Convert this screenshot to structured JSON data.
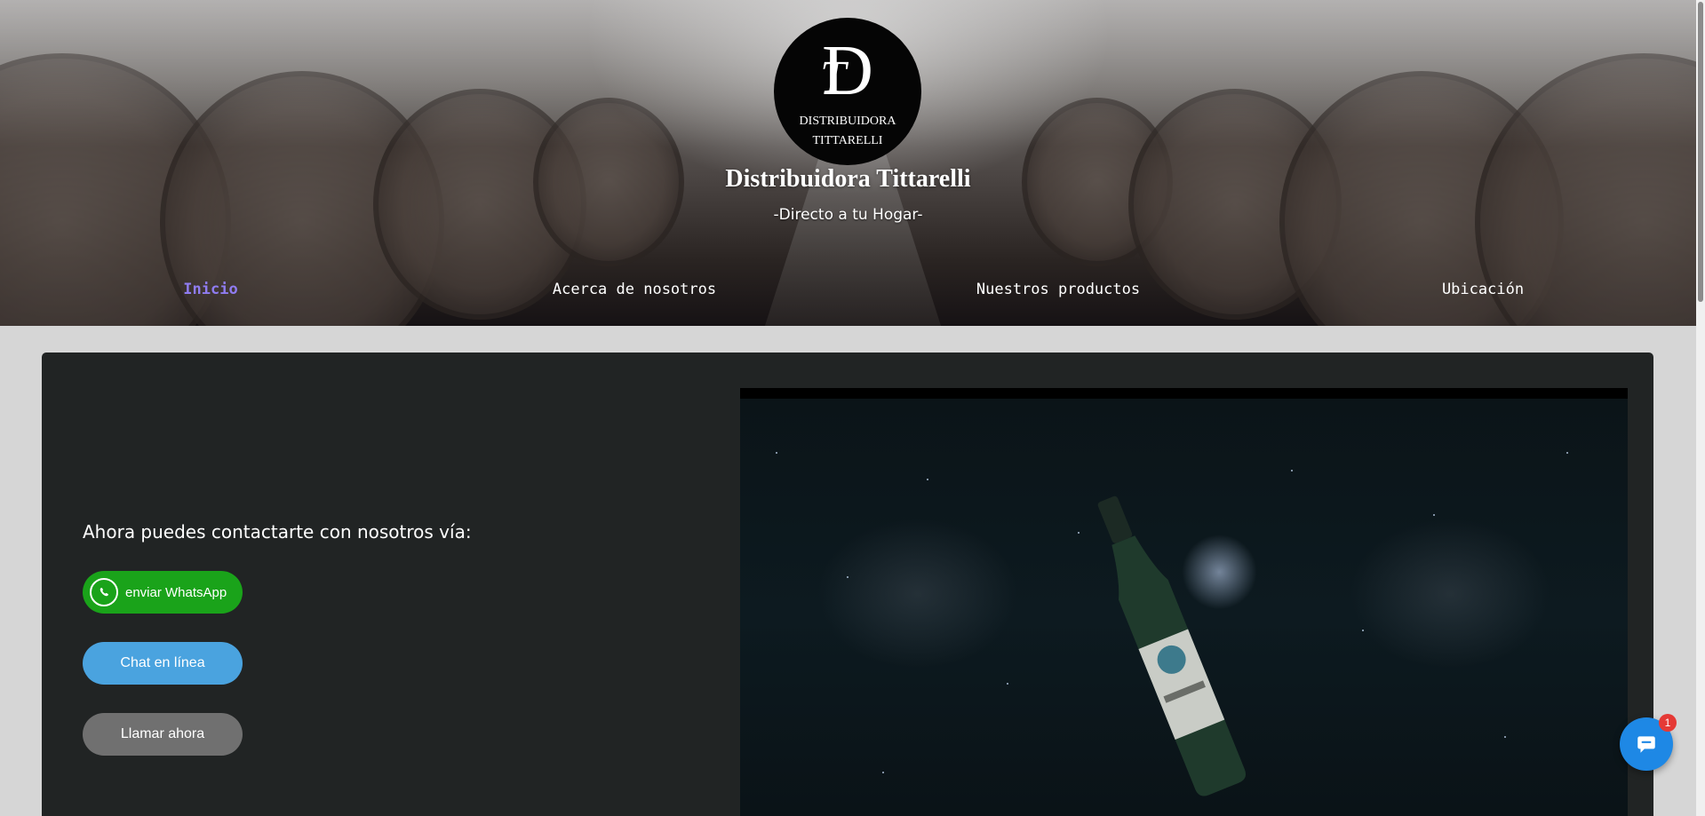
{
  "header": {
    "logo_monogram": "D",
    "logo_monogram_inner": "T",
    "logo_line1": "DISTRIBUIDORA",
    "logo_line2": "TITTARELLI",
    "title": "Distribuidora Tittarelli",
    "subtitle": "-Directo a tu Hogar-"
  },
  "nav": {
    "items": [
      {
        "label": "Inicio",
        "active": true
      },
      {
        "label": "Acerca de nosotros",
        "active": false
      },
      {
        "label": "Nuestros productos",
        "active": false
      },
      {
        "label": "Ubicación",
        "active": false
      }
    ]
  },
  "contact": {
    "heading": "Ahora puedes contactarte con nosotros vía:",
    "whatsapp_label": "enviar WhatsApp",
    "chat_label": "Chat en línea",
    "call_label": "Llamar ahora"
  },
  "chat_widget": {
    "badge_count": "1"
  },
  "colors": {
    "nav_active": "#8f7cf0",
    "whatsapp": "#1aa31a",
    "chat": "#4aa3df",
    "call": "#707070",
    "card_bg": "#212424",
    "fab": "#1e88e5"
  }
}
